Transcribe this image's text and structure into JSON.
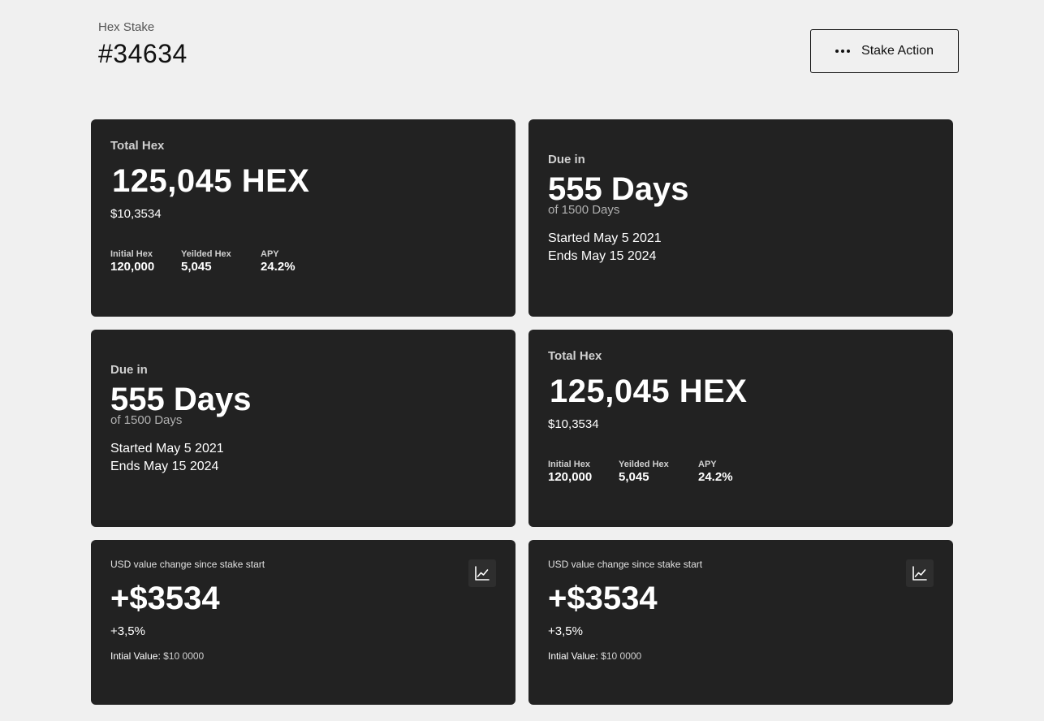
{
  "header": {
    "subtitle": "Hex Stake",
    "title": "#34634",
    "action_label": "Stake Action"
  },
  "total_cards": [
    {
      "label": "Total Hex",
      "amount": "125,045 HEX",
      "usd": "$10,3534",
      "stats": [
        {
          "label": "Initial Hex",
          "value": "120,000"
        },
        {
          "label": "Yeilded Hex",
          "value": "5,045"
        },
        {
          "label": "APY",
          "value": "24.2%"
        }
      ]
    },
    {
      "label": "Total Hex",
      "amount": "125,045 HEX",
      "usd": "$10,3534",
      "stats": [
        {
          "label": "Initial Hex",
          "value": "120,000"
        },
        {
          "label": "Yeilded Hex",
          "value": "5,045"
        },
        {
          "label": "APY",
          "value": "24.2%"
        }
      ]
    }
  ],
  "due_cards": [
    {
      "label": "Due in",
      "days": "555 Days",
      "of_days": "of 1500 Days",
      "started": "Started May 5 2021",
      "ends": "Ends May 15 2024"
    },
    {
      "label": "Due in",
      "days": "555 Days",
      "of_days": "of 1500 Days",
      "started": "Started May 5 2021",
      "ends": "Ends May 15 2024"
    }
  ],
  "change_cards": [
    {
      "label": "USD value change since stake start",
      "value": "+$3534",
      "percent": "+3,5%",
      "initial_label": "Intial Value:",
      "initial_value": "$10 0000",
      "icon": "line-chart-icon"
    },
    {
      "label": "USD value change since stake start",
      "value": "+$3534",
      "percent": "+3,5%",
      "initial_label": "Intial Value:",
      "initial_value": "$10 0000",
      "icon": "line-chart-icon"
    }
  ]
}
